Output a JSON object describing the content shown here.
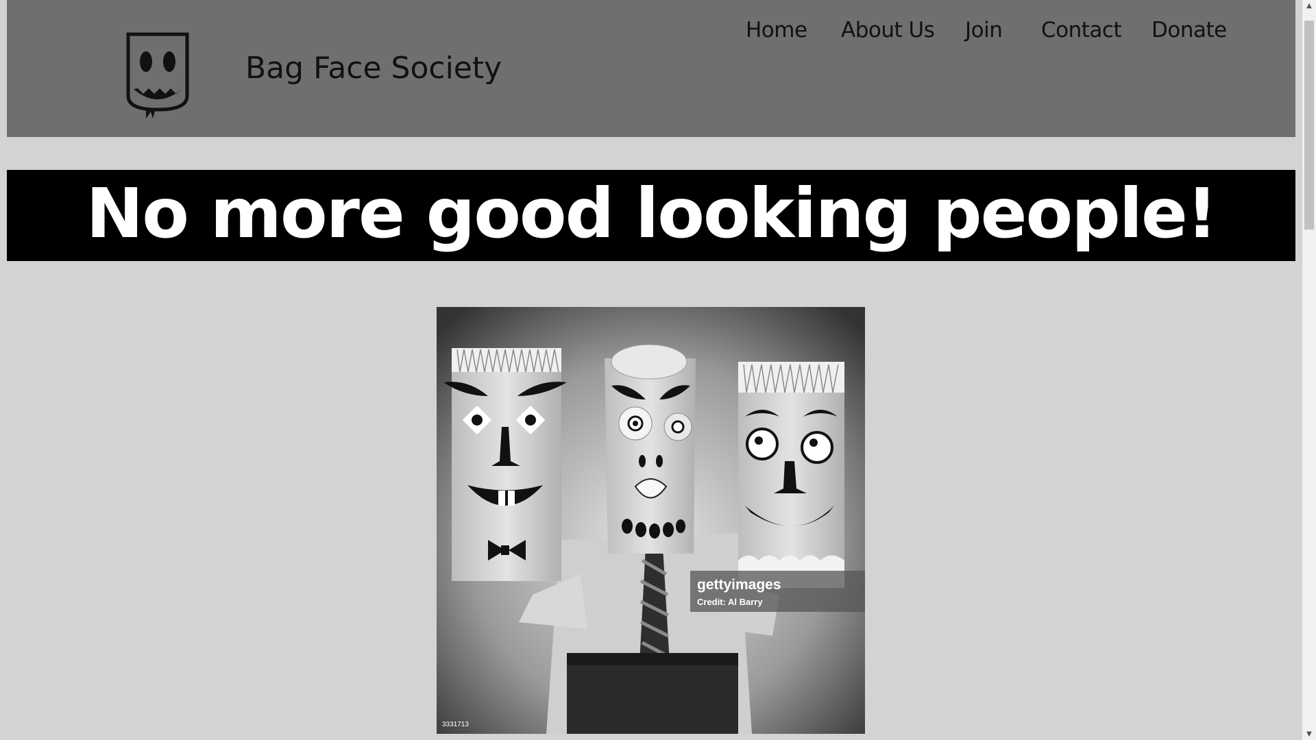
{
  "header": {
    "logo_icon": "bag-face-logo-icon",
    "site_title": "Bag Face Society",
    "nav": [
      {
        "id": "home",
        "label": "Home"
      },
      {
        "id": "about",
        "label": "About Us"
      },
      {
        "id": "join",
        "label": "Join"
      },
      {
        "id": "contact",
        "label": "Contact"
      },
      {
        "id": "donate",
        "label": "Donate"
      }
    ]
  },
  "banner": {
    "headline": "No more good looking people!"
  },
  "photo": {
    "watermark_brand": "gettyimages",
    "watermark_credit": "Credit: Al Barry",
    "image_number": "3331713"
  },
  "colors": {
    "page_bg": "#d3d3d3",
    "header_bg": "#6f6f6f",
    "banner_bg": "#000000",
    "banner_text": "#ffffff"
  }
}
